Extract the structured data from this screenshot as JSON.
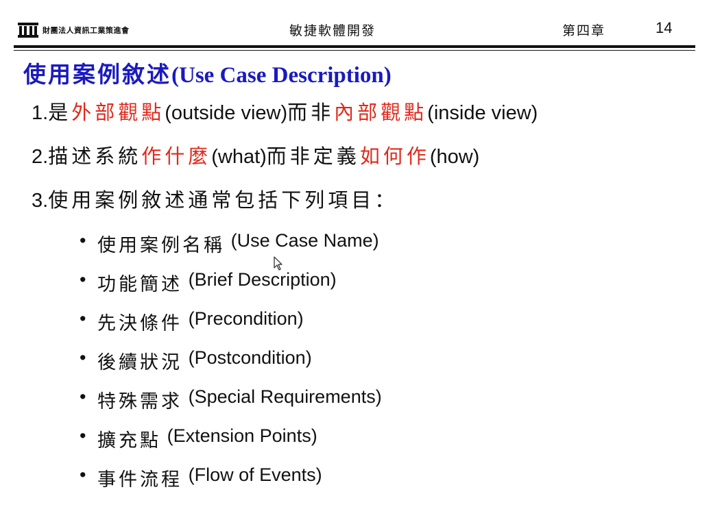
{
  "header": {
    "org_name": "財團法人資訊工業策進會",
    "course_title": "敏捷軟體開發",
    "chapter": "第四章",
    "page_number": "14"
  },
  "title": {
    "cjk": "使用案例敘述",
    "en": "(Use Case Description)"
  },
  "points": [
    {
      "num": "1.",
      "segments": [
        {
          "text": "是",
          "type": "cjk"
        },
        {
          "text": "外部觀點",
          "type": "cjk-red"
        },
        {
          "text": "(outside view)",
          "type": "latin"
        },
        {
          "text": "而非",
          "type": "cjk"
        },
        {
          "text": "內部觀點",
          "type": "cjk-red"
        },
        {
          "text": "(inside view)",
          "type": "latin"
        }
      ]
    },
    {
      "num": "2.",
      "segments": [
        {
          "text": "描述系統",
          "type": "cjk"
        },
        {
          "text": "作什麼",
          "type": "cjk-red"
        },
        {
          "text": "(what)",
          "type": "latin"
        },
        {
          "text": "而非定義",
          "type": "cjk"
        },
        {
          "text": "如何作",
          "type": "cjk-red"
        },
        {
          "text": "(how)",
          "type": "latin"
        }
      ]
    },
    {
      "num": "3.",
      "segments": [
        {
          "text": "使用案例敘述通常包括下列項目：",
          "type": "cjk"
        }
      ]
    }
  ],
  "bullets": [
    {
      "cjk": "使用案例名稱",
      "en": "(Use Case Name)"
    },
    {
      "cjk": "功能簡述",
      "en": "(Brief Description)"
    },
    {
      "cjk": "先決條件",
      "en": "(Precondition)"
    },
    {
      "cjk": "後續狀況",
      "en": "(Postcondition)"
    },
    {
      "cjk": "特殊需求",
      "en": "(Special Requirements)"
    },
    {
      "cjk": "擴充點",
      "en": "(Extension Points)"
    },
    {
      "cjk": "事件流程",
      "en": "(Flow of Events)"
    }
  ],
  "bullet_symbol": "•",
  "colors": {
    "title": "#1a1ac0",
    "highlight": "#e0291c",
    "text": "#111111"
  },
  "icons": {
    "logo": "institution-building-icon",
    "cursor": "mouse-pointer-icon"
  }
}
